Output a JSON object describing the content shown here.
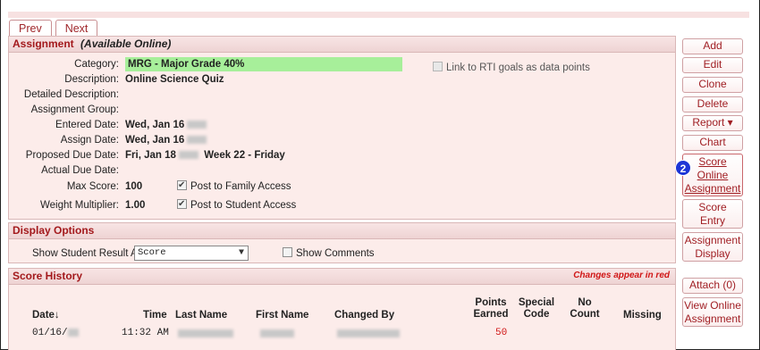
{
  "nav": {
    "prev": "Prev",
    "next": "Next"
  },
  "assignment": {
    "header": "Assignment",
    "header_sub": "(Available Online)",
    "rti_label": "Link to RTI goals as data points",
    "fields": [
      {
        "label": "Category:",
        "value": "MRG - Major Grade 40%"
      },
      {
        "label": "Description:",
        "value": "Online Science Quiz"
      },
      {
        "label": "Detailed Description:",
        "value": ""
      },
      {
        "label": "Assignment Group:",
        "value": ""
      },
      {
        "label": "Entered Date:",
        "value": "Wed, Jan 16"
      },
      {
        "label": "Assign Date:",
        "value": "Wed, Jan 16"
      },
      {
        "label": "Proposed Due Date:",
        "value": "Fri, Jan 18",
        "extra": "Week 22 - Friday"
      },
      {
        "label": "Actual Due Date:",
        "value": ""
      },
      {
        "label": "Max Score:",
        "value": "100",
        "check": "Post to Family Access"
      },
      {
        "label": "Weight Multiplier:",
        "value": "1.00",
        "check": "Post to Student Access"
      }
    ]
  },
  "display_options": {
    "header": "Display Options",
    "show_result_label": "Show Student Result As:",
    "show_result_value": "Score",
    "show_comments": "Show Comments"
  },
  "score_history": {
    "header": "Score History",
    "note": "Changes appear in red",
    "columns": [
      "Date↓",
      "Time",
      "Last Name",
      "First Name",
      "Changed By",
      "Points Earned",
      "Special Code",
      "No Count",
      "Missing"
    ],
    "row": {
      "date": "01/16/",
      "time": "11:32 AM",
      "points": "50"
    }
  },
  "sidebar": {
    "add": "Add",
    "edit": "Edit",
    "clone": "Clone",
    "delete": "Delete",
    "report": "Report ▾",
    "chart": "Chart",
    "score_online": [
      "Score",
      "Online",
      "Assignment"
    ],
    "score_entry": [
      "Score",
      "Entry"
    ],
    "assignment_display": [
      "Assignment",
      "Display"
    ],
    "attach": "Attach (0)",
    "view_online": [
      "View Online",
      "Assignment"
    ],
    "badge": "2"
  },
  "colors": {
    "accent": "#a3191c",
    "panel": "#fcecea",
    "highlight": "#a7ef9a",
    "badge": "#1c35d6",
    "note": "#d01616"
  }
}
